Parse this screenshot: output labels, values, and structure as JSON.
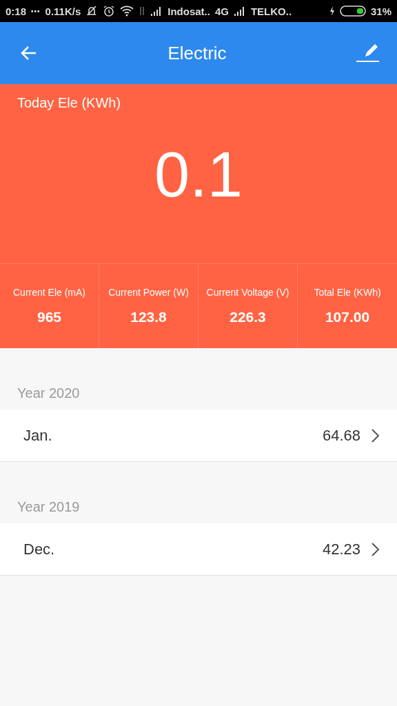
{
  "status_bar": {
    "time": "0:18",
    "dots": "•••",
    "speed": "0.11K/s",
    "carrier_1": "Indosat..",
    "network": "4G",
    "carrier_2": "TELKO..",
    "battery": "31%"
  },
  "header": {
    "title": "Electric"
  },
  "today": {
    "label": "Today Ele (KWh)",
    "value": "0.1"
  },
  "stats": [
    {
      "label": "Current Ele (mA)",
      "value": "965"
    },
    {
      "label": "Current Power (W)",
      "value": "123.8"
    },
    {
      "label": "Current Voltage (V)",
      "value": "226.3"
    },
    {
      "label": "Total Ele (KWh)",
      "value": "107.00"
    }
  ],
  "years": [
    {
      "title": "Year 2020",
      "months": [
        {
          "name": "Jan.",
          "value": "64.68"
        }
      ]
    },
    {
      "title": "Year 2019",
      "months": [
        {
          "name": "Dec.",
          "value": "42.23"
        }
      ]
    }
  ]
}
